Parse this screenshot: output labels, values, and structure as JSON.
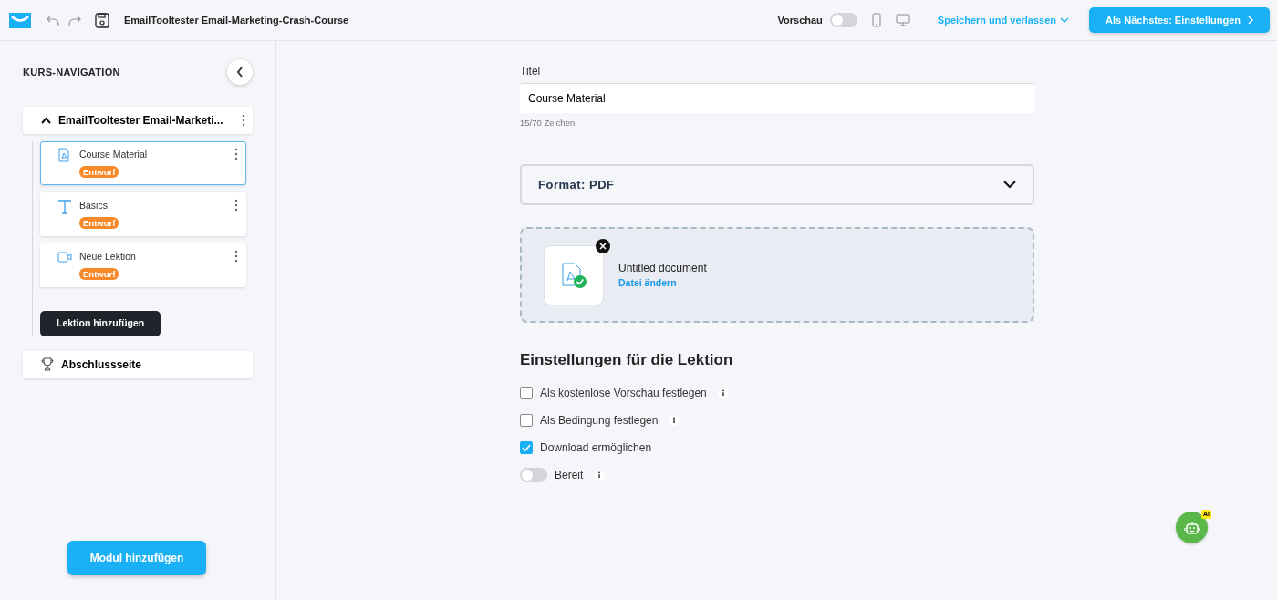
{
  "header": {
    "title": "EmailTooltester Email-Marketing-Crash-Course",
    "preview_label": "Vorschau",
    "preview_on": false,
    "save_menu": "Speichern und verlassen",
    "next_button": "Als Nächstes: Einstellungen"
  },
  "sidebar": {
    "heading": "KURS-NAVIGATION",
    "module": {
      "title": "EmailTooltester Email-Marketi...",
      "expanded": true
    },
    "lessons": [
      {
        "kind": "pdf",
        "title": "Course Material",
        "badge": "Entwurf",
        "selected": true
      },
      {
        "kind": "text",
        "title": "Basics",
        "badge": "Entwurf",
        "selected": false
      },
      {
        "kind": "video",
        "title": "Neue Lektion",
        "badge": "Entwurf",
        "selected": false
      }
    ],
    "add_lesson": "Lektion hinzufügen",
    "final_page": "Abschlussseite",
    "add_module": "Modul hinzufügen"
  },
  "form": {
    "title_label": "Titel",
    "title_value": "Course Material",
    "char_count": "15/70 Zeichen",
    "format": "Format: PDF",
    "file": {
      "name": "Untitled document",
      "action": "Datei ändern"
    },
    "settings_heading": "Einstellungen für die Lektion",
    "options": [
      {
        "kind": "checkbox",
        "label": "Als kostenlose Vorschau festlegen",
        "on": false,
        "info": true
      },
      {
        "kind": "checkbox",
        "label": "Als Bedingung festlegen",
        "on": false,
        "info": true
      },
      {
        "kind": "checkbox",
        "label": "Download ermöglichen",
        "on": true,
        "info": false
      },
      {
        "kind": "toggle",
        "label": "Bereit",
        "on": false,
        "info": true
      }
    ]
  },
  "assistant": {
    "badge": "AI"
  }
}
